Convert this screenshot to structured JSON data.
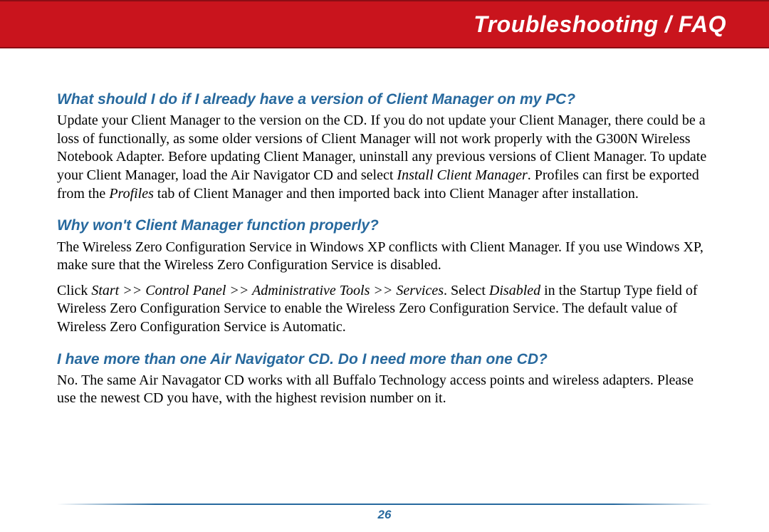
{
  "header": {
    "title": "Troubleshooting / FAQ"
  },
  "faq": {
    "q1": "What should I do if I already have a version of Client Manager on my PC?",
    "a1_pre": "Update your Client Manager to the version on the CD. If you do not update your Client Manager, there could be a loss of functionally, as some older versions of Client Manager will not work properly with the G300N Wireless Notebook Adapter. Before updating Client Manager, uninstall any previous versions of Client Manager. To update your Client Manager, load the Air Navigator CD and select ",
    "a1_em1": "Install Client Manager",
    "a1_mid1": ". Profiles can first be exported from the ",
    "a1_em2": "Profiles",
    "a1_post": " tab of Client Manager and then imported back into Client Manager after installation.",
    "q2": "Why won't Client Manager function properly?",
    "a2": "The Wireless Zero Configuration Service in Windows XP conflicts with Client Manager.  If you use Windows XP, make sure that the Wireless Zero Configuration Service is disabled.",
    "a2b_pre": "Click ",
    "a2b_em1": "Start >> Control Panel >> Administrative Tools >> Services",
    "a2b_mid": ". Select ",
    "a2b_em2": "Disabled",
    "a2b_post": " in the Startup Type field of Wireless Zero Configuration Service to enable the Wireless Zero Configuration Service. The default value of Wireless Zero Configuration Service is Automatic.",
    "q3": "I have more than one Air Navigator CD. Do I need more than one CD?",
    "a3": "No. The same Air Navagator CD works with all Buffalo Technology access points and wireless adapters. Please use the newest CD you have, with the highest revision number on it."
  },
  "page_number": "26"
}
